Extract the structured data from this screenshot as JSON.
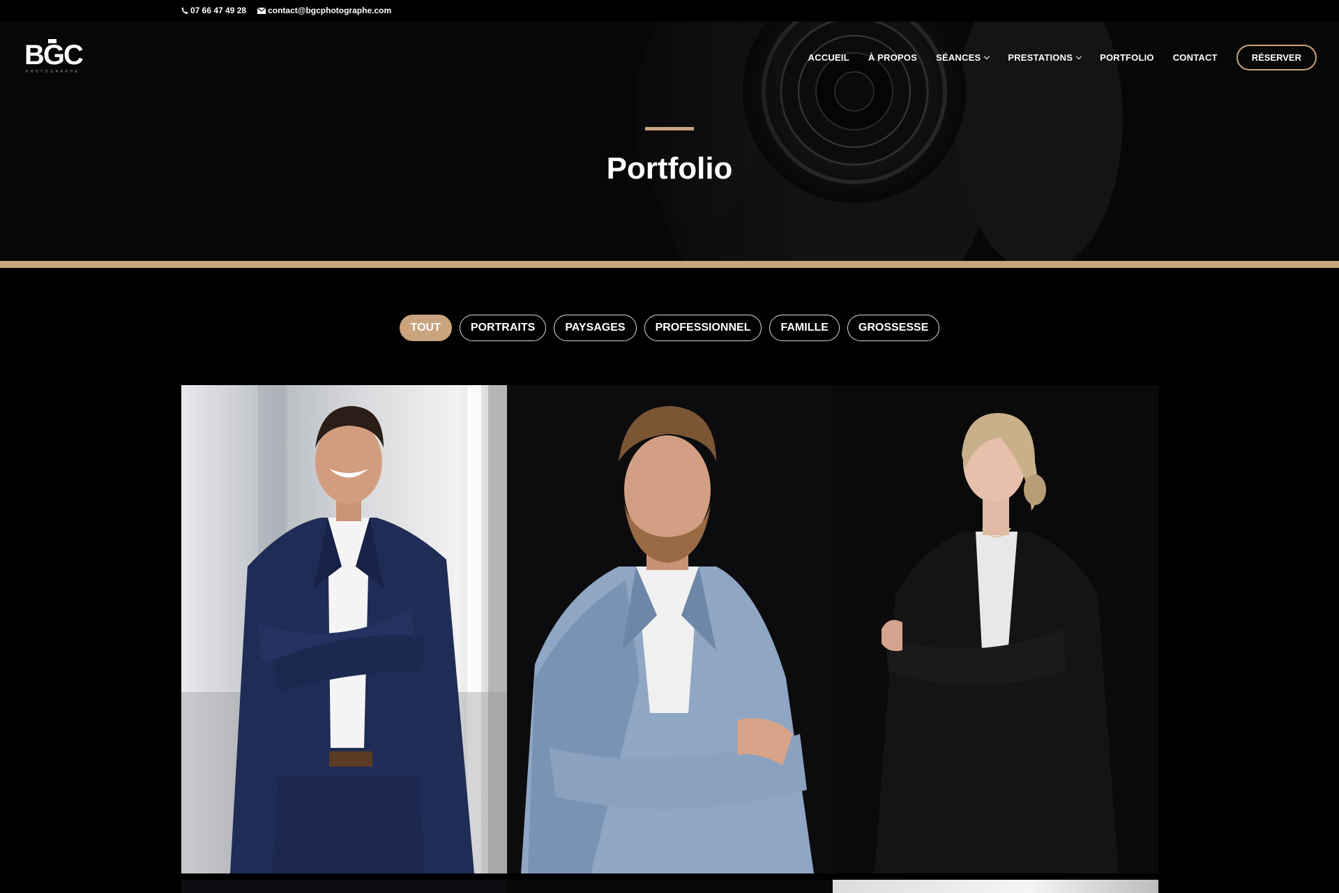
{
  "topbar": {
    "phone": "07 66 47 49 28",
    "email": "contact@bgcphotographe.com",
    "phone_icon": "phone-icon",
    "email_icon": "envelope-icon"
  },
  "brand": {
    "logo_text": "BGC",
    "logo_subtext": "PHOTOGRAPHE"
  },
  "nav": {
    "items": [
      {
        "label": "ACCUEIL",
        "dropdown": false
      },
      {
        "label": "À PROPOS",
        "dropdown": false
      },
      {
        "label": "SÉANCES",
        "dropdown": true
      },
      {
        "label": "PRESTATIONS",
        "dropdown": true
      },
      {
        "label": "PORTFOLIO",
        "dropdown": false
      },
      {
        "label": "CONTACT",
        "dropdown": false
      }
    ],
    "cta_label": "RÉSERVER"
  },
  "hero": {
    "title": "Portfolio"
  },
  "filters": {
    "items": [
      "TOUT",
      "PORTRAITS",
      "PAYSAGES",
      "PROFESSIONNEL",
      "FAMILLE",
      "GROSSESSE"
    ],
    "active": "TOUT"
  },
  "gallery": {
    "photos": [
      {
        "subject": "man in navy suit, arms crossed, bright office background"
      },
      {
        "subject": "bearded man in light blue blazer, dark studio background"
      },
      {
        "subject": "blonde woman in black blazer, dark studio background"
      }
    ]
  },
  "colors": {
    "accent": "#c9a47e",
    "background": "#000000",
    "text": "#ffffff"
  }
}
